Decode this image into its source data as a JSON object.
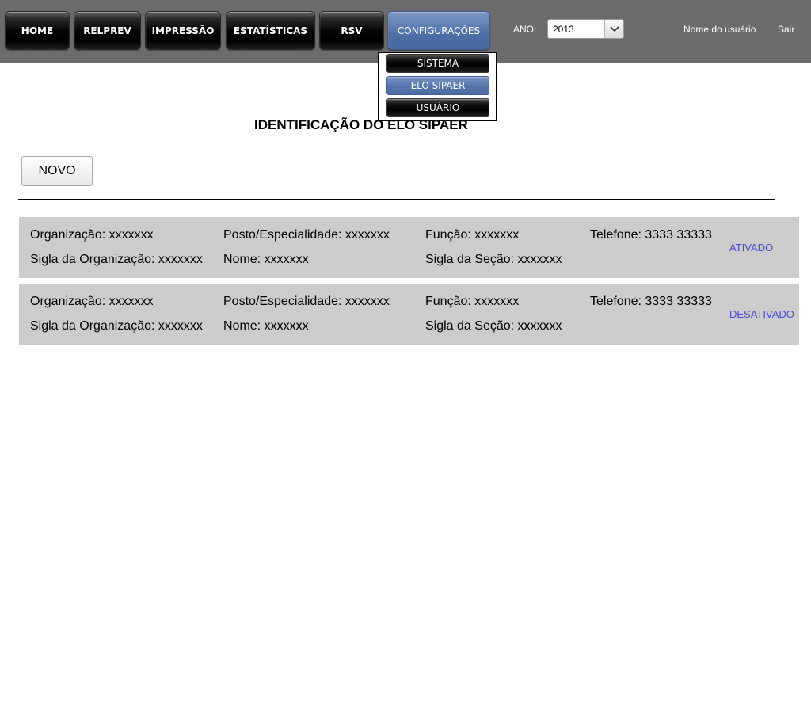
{
  "nav": {
    "items": [
      {
        "label": "HOME"
      },
      {
        "label": "RELPREV"
      },
      {
        "label": "IMPRESSÃO"
      },
      {
        "label": "ESTATÍSTICAS"
      },
      {
        "label": "RSV"
      },
      {
        "label": "CONFIGURAÇÕES"
      }
    ],
    "active": "CONFIGURAÇÕES"
  },
  "year": {
    "label": "ANO:",
    "value": "2013"
  },
  "user": {
    "name": "Nome do usuário",
    "logout": "Sair"
  },
  "dropdown": {
    "items": [
      {
        "label": "SISTEMA"
      },
      {
        "label": "ELO SIPAER"
      },
      {
        "label": "USUÁRIO"
      }
    ],
    "active": "ELO SIPAER"
  },
  "page": {
    "title": "IDENTIFICAÇÃO DO ELO SIPAER"
  },
  "actions": {
    "new_label": "NOVO"
  },
  "records": [
    {
      "organizacao": "Organização: xxxxxxx",
      "sigla_organizacao": "Sigla da Organização: xxxxxxx",
      "posto": "Posto/Especialidade: xxxxxxx",
      "nome": "Nome: xxxxxxx",
      "funcao": "Função: xxxxxxx",
      "sigla_secao": "Sigla da Seção: xxxxxxx",
      "telefone": "Telefone: 3333 33333",
      "status": "ATIVADO"
    },
    {
      "organizacao": "Organização: xxxxxxx",
      "sigla_organizacao": "Sigla da Organização: xxxxxxx",
      "posto": "Posto/Especialidade: xxxxxxx",
      "nome": "Nome: xxxxxxx",
      "funcao": "Função: xxxxxxx",
      "sigla_secao": "Sigla da Seção: xxxxxxx",
      "telefone": "Telefone: 3333 33333",
      "status": "DESATIVADO"
    }
  ],
  "colors": {
    "topbar": "#6b6b6b",
    "active_blue": "#4e6ea6",
    "link": "#4a4ad8",
    "record_bg": "#cccccc"
  }
}
